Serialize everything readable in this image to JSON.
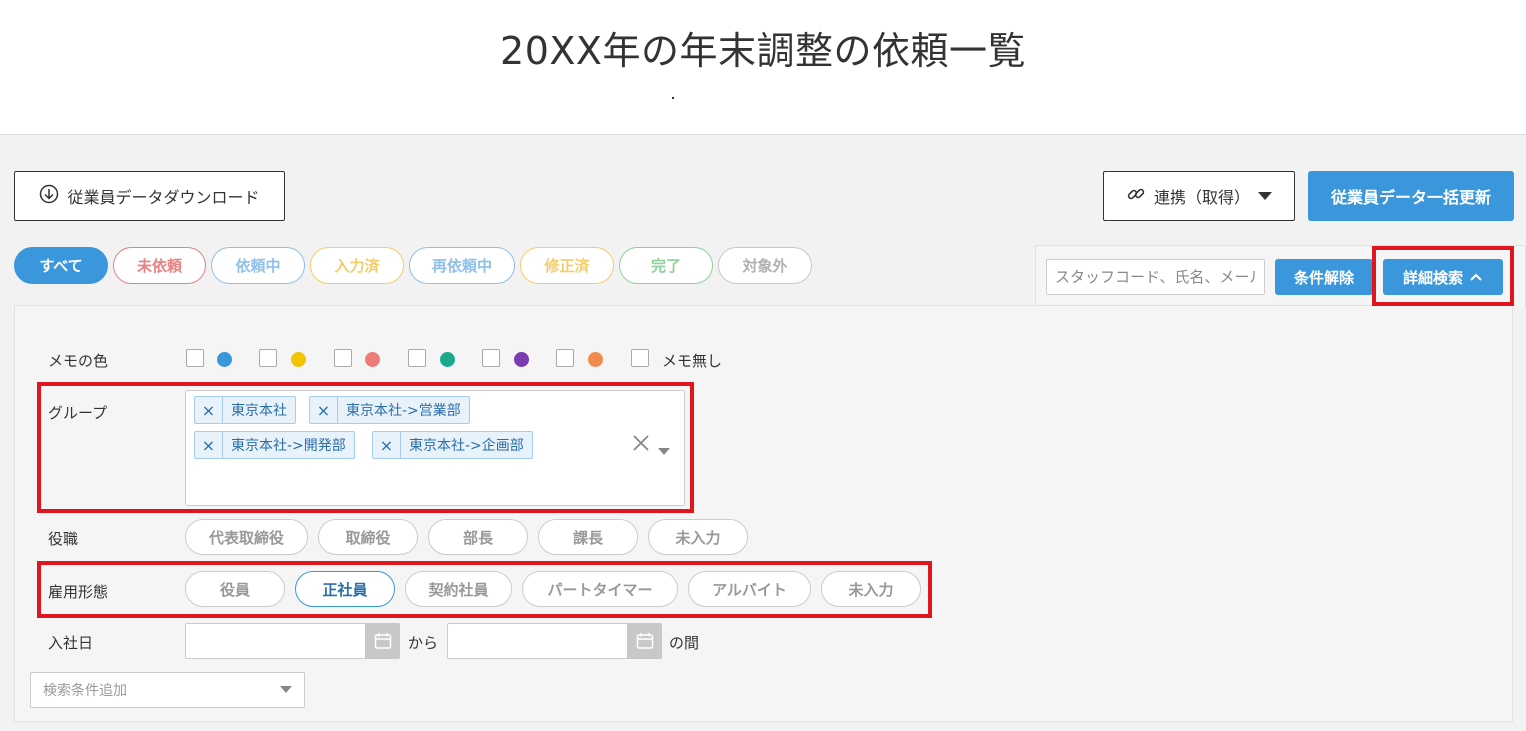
{
  "page_title": "20XX年の年末調整の依頼一覧",
  "toolbar": {
    "download_label": "従業員データダウンロード",
    "sync_label": "連携（取得）",
    "bulk_update_label": "従業員データ一括更新"
  },
  "status_filters": [
    {
      "label": "すべて",
      "color": "#3a97dc"
    },
    {
      "label": "未依頼",
      "color": "#e88080"
    },
    {
      "label": "依頼中",
      "color": "#8fc0e8"
    },
    {
      "label": "入力済",
      "color": "#f5cc6a"
    },
    {
      "label": "再依頼中",
      "color": "#8fc0e8"
    },
    {
      "label": "修正済",
      "color": "#f5cc6a"
    },
    {
      "label": "完了",
      "color": "#8ed19c"
    },
    {
      "label": "対象外",
      "color": "#b0b0b0"
    }
  ],
  "search": {
    "placeholder": "スタッフコード、氏名、メール",
    "clear_label": "条件解除",
    "advanced_label": "詳細検索"
  },
  "filters": {
    "memo_color": {
      "label": "メモの色",
      "colors": [
        "#3a97dc",
        "#f5c400",
        "#ef7b7b",
        "#1aa98a",
        "#7a3db0",
        "#f28a4e"
      ],
      "no_memo_label": "メモ無し"
    },
    "group": {
      "label": "グループ",
      "tags": [
        "東京本社",
        "東京本社->営業部",
        "東京本社->開発部",
        "東京本社->企画部"
      ]
    },
    "position": {
      "label": "役職",
      "options": [
        "代表取締役",
        "取締役",
        "部長",
        "課長",
        "未入力"
      ]
    },
    "employment_type": {
      "label": "雇用形態",
      "options": [
        "役員",
        "正社員",
        "契約社員",
        "パートタイマー",
        "アルバイト",
        "未入力"
      ],
      "selected": "正社員"
    },
    "hire_date": {
      "label": "入社日",
      "from_label": "から",
      "between_label": "の間"
    },
    "add_condition_placeholder": "検索条件追加"
  }
}
